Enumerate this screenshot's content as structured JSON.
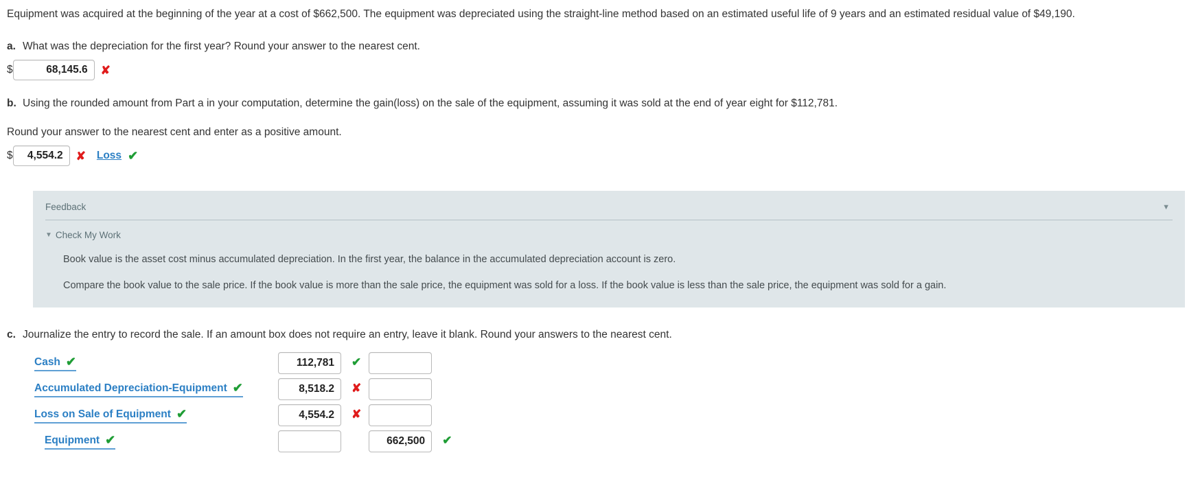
{
  "intro": "Equipment was acquired at the beginning of the year at a cost of $662,500. The equipment was depreciated using the straight-line method based on an estimated useful life of 9 years and an estimated residual value of $49,190.",
  "part_a": {
    "letter": "a.",
    "question": "What was the depreciation for the first year? Round your answer to the nearest cent.",
    "currency_symbol": "$",
    "value": "68,145.6",
    "mark": "✘",
    "mark_state": "wrong"
  },
  "part_b": {
    "letter": "b.",
    "question": "Using the rounded amount from Part a in your computation, determine the gain(loss) on the sale of the equipment, assuming it was sold at the end of year eight for $112,781.",
    "sub_instruction": "Round your answer to the nearest cent and enter as a positive amount.",
    "currency_symbol": "$",
    "value": "4,554.2",
    "mark": "✘",
    "mark_state": "wrong",
    "gain_loss_label": "Loss",
    "gain_loss_mark": "✔",
    "gain_loss_mark_state": "right"
  },
  "feedback": {
    "title": "Feedback",
    "collapse_caret": "▼",
    "check_my_work_caret": "▼",
    "check_my_work_label": "Check My Work",
    "lines": [
      "Book value is the asset cost minus accumulated depreciation. In the first year, the balance in the accumulated depreciation account is zero.",
      "Compare the book value to the sale price. If the book value is more than the sale price, the equipment was sold for a loss. If the book value is less than the sale price, the equipment was sold for a gain."
    ]
  },
  "part_c": {
    "letter": "c.",
    "instruction": "Journalize the entry to record the sale. If an amount box does not require an entry, leave it blank. Round your answers to the nearest cent.",
    "rows": [
      {
        "account": "Cash",
        "account_mark": "✔",
        "account_mark_state": "right",
        "indent": false,
        "debit": "112,781",
        "debit_mark": "✔",
        "debit_mark_state": "right",
        "credit": "",
        "credit_mark": "",
        "credit_mark_state": "none"
      },
      {
        "account": "Accumulated Depreciation-Equipment",
        "account_mark": "✔",
        "account_mark_state": "right",
        "indent": false,
        "debit": "8,518.2",
        "debit_mark": "✘",
        "debit_mark_state": "wrong",
        "credit": "",
        "credit_mark": "",
        "credit_mark_state": "none"
      },
      {
        "account": "Loss on Sale of Equipment",
        "account_mark": "✔",
        "account_mark_state": "right",
        "indent": false,
        "debit": "4,554.2",
        "debit_mark": "✘",
        "debit_mark_state": "wrong",
        "credit": "",
        "credit_mark": "",
        "credit_mark_state": "none"
      },
      {
        "account": "Equipment",
        "account_mark": "✔",
        "account_mark_state": "right",
        "indent": true,
        "debit": "",
        "debit_mark": "",
        "debit_mark_state": "none",
        "credit": "662,500",
        "credit_mark": "✔",
        "credit_mark_state": "right"
      }
    ]
  },
  "colors": {
    "link_blue": "#2b7fc4",
    "correct_green": "#1f9d35",
    "wrong_red": "#e01b1b",
    "feedback_bg": "#dfe6e9"
  }
}
